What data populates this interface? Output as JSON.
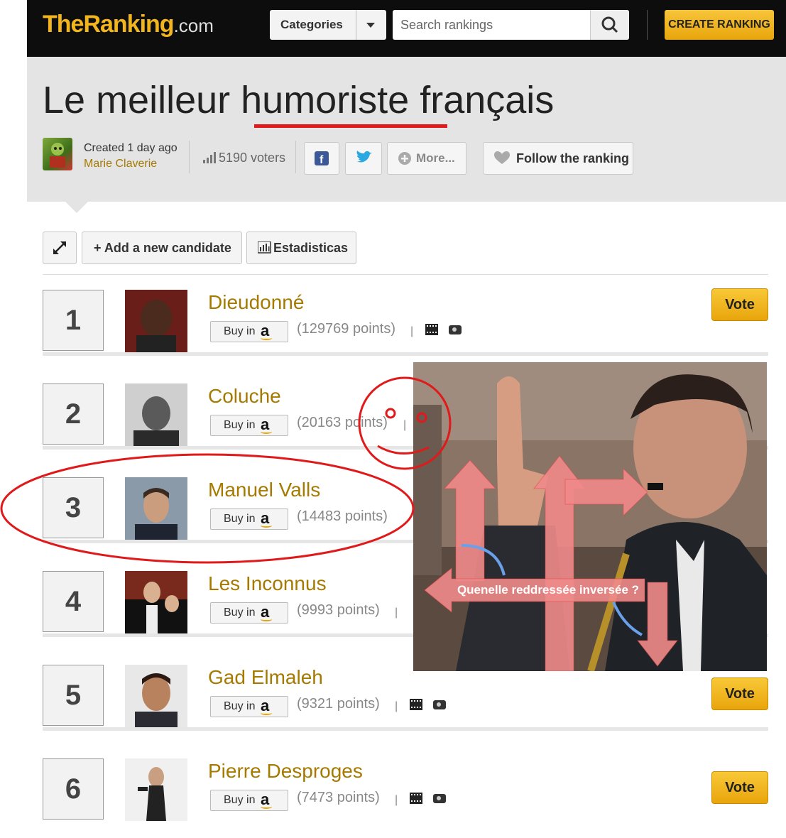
{
  "topbar": {
    "logo_main": "TheRanking",
    "logo_domain": ".com",
    "categories_label": "Categories",
    "search_placeholder": "Search rankings",
    "create_label": "CREATE RANKING"
  },
  "header": {
    "title": "Le meilleur humoriste français",
    "created": "Created 1 day ago",
    "author": "Marie Claverie",
    "voters": "5190 voters",
    "more_label": "More...",
    "follow_label": "Follow the ranking"
  },
  "toolbar": {
    "add_label": "+ Add a new candidate",
    "stats_label": "Estadisticas"
  },
  "buy_label": "Buy in",
  "vote_label": "Vote",
  "candidates": [
    {
      "rank": "1",
      "name": "Dieudonné",
      "points": "(129769 points)"
    },
    {
      "rank": "2",
      "name": "Coluche",
      "points": "(20163 points)"
    },
    {
      "rank": "3",
      "name": "Manuel Valls",
      "points": "(14483 points)"
    },
    {
      "rank": "4",
      "name": "Les Inconnus",
      "points": "(9993 points)"
    },
    {
      "rank": "5",
      "name": "Gad Elmaleh",
      "points": "(9321 points)"
    },
    {
      "rank": "6",
      "name": "Pierre Desproges",
      "points": "(7473 points)"
    }
  ],
  "overlay": {
    "caption": "Quenelle reddressée inversée ?"
  },
  "colors": {
    "accent": "#f2b51c",
    "name_gold": "#a67a00",
    "annotation_red": "#e0191a"
  }
}
